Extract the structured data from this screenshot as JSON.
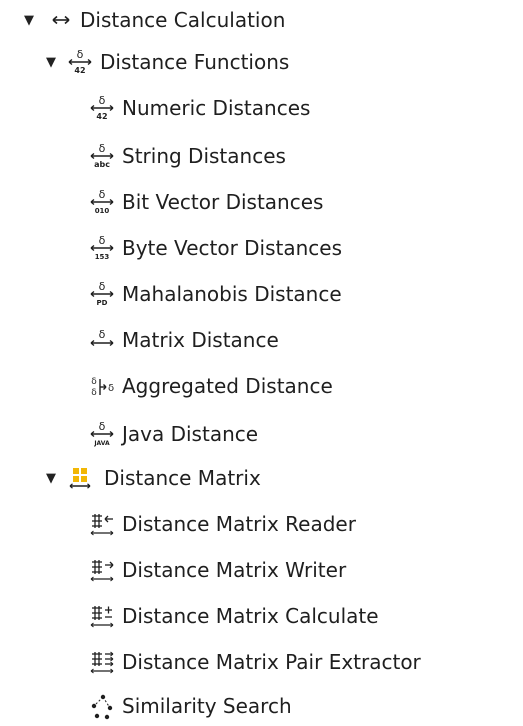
{
  "tree": {
    "root": {
      "label": "Distance Calculation",
      "icon": "arrow-double-icon",
      "expanded": true,
      "children": {
        "distance_functions": {
          "label": "Distance Functions",
          "icon": "numeric-distance-icon",
          "expanded": true,
          "items": [
            {
              "label": "Numeric Distances",
              "icon": "numeric-distance-icon"
            },
            {
              "label": "String Distances",
              "icon": "string-distance-icon"
            },
            {
              "label": "Bit Vector Distances",
              "icon": "bit-vector-distance-icon"
            },
            {
              "label": "Byte Vector Distances",
              "icon": "byte-vector-distance-icon"
            },
            {
              "label": "Mahalanobis Distance",
              "icon": "mahalanobis-distance-icon"
            },
            {
              "label": "Matrix Distance",
              "icon": "matrix-distance-icon"
            },
            {
              "label": "Aggregated Distance",
              "icon": "aggregated-distance-icon"
            },
            {
              "label": "Java Distance",
              "icon": "java-distance-icon"
            }
          ]
        },
        "distance_matrix": {
          "label": "Distance Matrix",
          "icon": "distance-matrix-icon",
          "expanded": true,
          "items": [
            {
              "label": "Distance Matrix Reader",
              "icon": "matrix-reader-icon"
            },
            {
              "label": "Distance Matrix Writer",
              "icon": "matrix-writer-icon"
            },
            {
              "label": "Distance Matrix Calculate",
              "icon": "matrix-calculate-icon"
            },
            {
              "label": "Distance Matrix Pair Extractor",
              "icon": "matrix-pair-extractor-icon"
            },
            {
              "label": "Similarity Search",
              "icon": "similarity-search-icon"
            }
          ]
        }
      }
    },
    "glyphs": {
      "numeric_sub": "42",
      "string_sub": "abc",
      "bit_sub": "010",
      "byte_sub": "153",
      "mahalanobis_sub": "PD",
      "java_sub": "JAVA"
    },
    "colors": {
      "text": "#1f1f1f",
      "matrix_icon": "#f2b705"
    }
  }
}
